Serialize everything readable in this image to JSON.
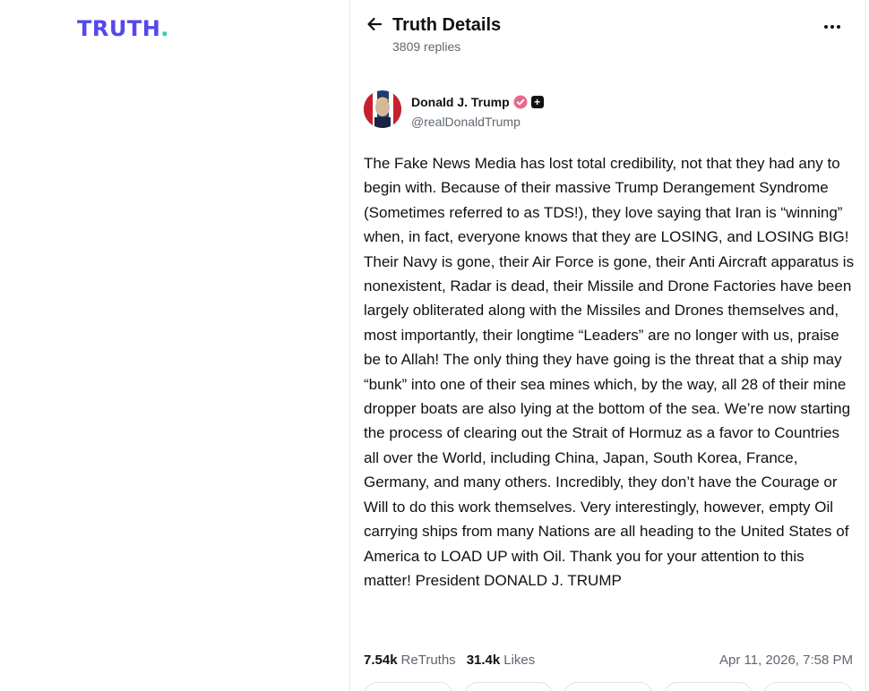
{
  "brand": {
    "logo_text": "TRUTH",
    "logo_dot": ".",
    "logo_color": "#5448ee",
    "dot_color": "#17d5b4"
  },
  "header": {
    "title": "Truth Details",
    "replies": "3809 replies",
    "back_icon": "arrow-left-icon",
    "more_icon": "ellipsis-horizontal-icon"
  },
  "author": {
    "name": "Donald J. Trump",
    "handle": "@realDonaldTrump",
    "verified_color": "#e86a8a"
  },
  "post": {
    "text": "The Fake News Media has lost total credibility, not that they had any to begin with. Because of their massive Trump Derangement Syndrome (Sometimes referred to as TDS!), they love saying that Iran is “winning” when, in fact, everyone knows that they are LOSING, and LOSING BIG! Their Navy is gone, their Air Force is gone, their Anti Aircraft apparatus is nonexistent, Radar is dead, their Missile and Drone Factories have been largely obliterated along with the Missiles and Drones themselves and, most importantly, their longtime “Leaders” are no longer with us, praise be to Allah! The only thing they have going is the threat that a ship may “bunk” into one of their sea mines which, by the way, all 28 of their mine dropper boats are also lying at the bottom of the sea. We’re now starting the process of clearing out the Strait of Hormuz as a favor to Countries all over the World, including China, Japan, South Korea, France, Germany, and many others. Incredibly, they don’t have the Courage or Will to do this work themselves. Very interestingly, however, empty Oil carrying ships from many Nations are all heading to the United States of America to LOAD UP with Oil. Thank you for your attention to this matter! President DONALD J. TRUMP"
  },
  "stats": {
    "retruths_count": "7.54k",
    "retruths_label": "ReTruths",
    "likes_count": "31.4k",
    "likes_label": "Likes",
    "timestamp": "Apr 11, 2026, 7:58 PM"
  }
}
